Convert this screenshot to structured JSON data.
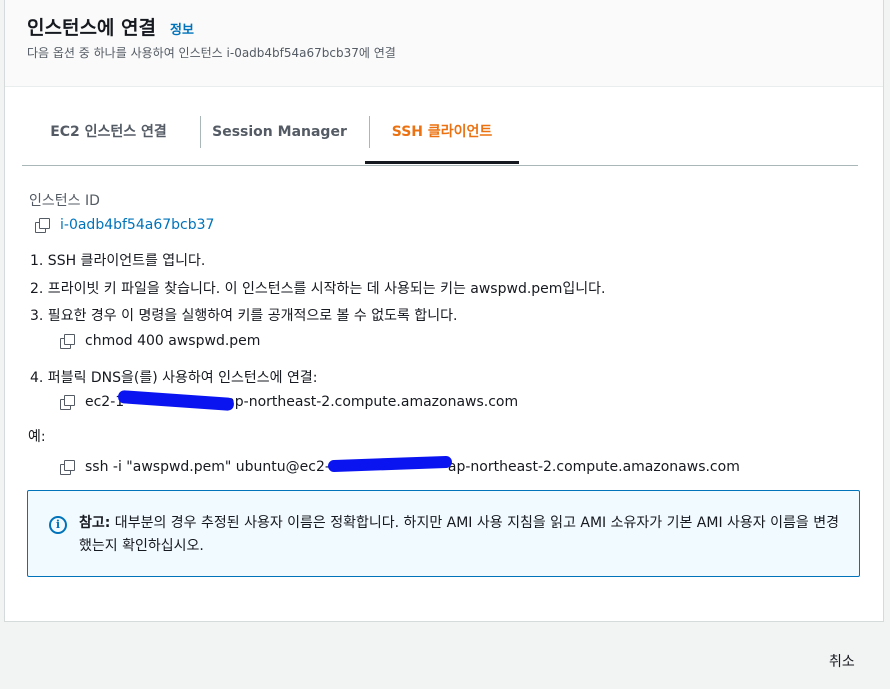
{
  "header": {
    "title": "인스턴스에 연결",
    "info_link": "정보",
    "subtitle": "다음 옵션 중 하나를 사용하여 인스턴스 i-0adb4bf54a67bcb37에 연결"
  },
  "tabs": [
    {
      "label": "EC2 인스턴스 연결",
      "active": false
    },
    {
      "label": "Session Manager",
      "active": false
    },
    {
      "label": "SSH 클라이언트",
      "active": true
    }
  ],
  "instance": {
    "label": "인스턴스 ID",
    "id": "i-0adb4bf54a67bcb37"
  },
  "steps": [
    "1. SSH 클라이언트를 엽니다.",
    "2. 프라이빗 키 파일을 찾습니다. 이 인스턴스를 시작하는 데 사용되는 키는 awspwd.pem입니다.",
    "3. 필요한 경우 이 명령을 실행하여 키를 공개적으로 볼 수 없도록 합니다.",
    "4. 퍼블릭 DNS을(를) 사용하여 인스턴스에 연결:"
  ],
  "commands": {
    "chmod": "chmod 400 awspwd.pem",
    "dns_prefix": "ec2-1",
    "dns_suffix": "ap-northeast-2.compute.amazonaws.com",
    "example_label": "예:",
    "ssh_prefix": "ssh -i \"awspwd.pem\" ubuntu@ec2-",
    "ssh_suffix": "ap-northeast-2.compute.amazonaws.com"
  },
  "notice": {
    "title": "참고:",
    "body": " 대부분의 경우 추정된 사용자 이름은 정확합니다. 하지만 AMI 사용 지침을 읽고 AMI 소유자가 기본 AMI 사용자 이름을 변경했는지 확인하십시오."
  },
  "footer": {
    "cancel_label": "취소"
  },
  "colors": {
    "accent": "#ec7211",
    "link": "#0073bb",
    "redaction": "#0a14f0"
  }
}
